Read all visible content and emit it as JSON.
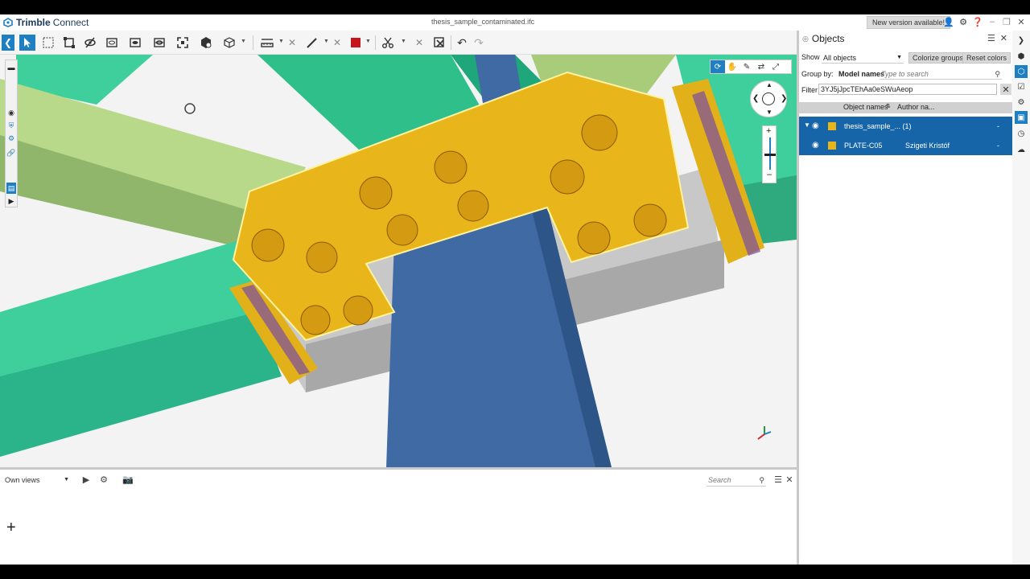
{
  "app": {
    "brand_bold": "Trimble",
    "brand_light": "Connect",
    "filename": "thesis_sample_contaminated.ifc",
    "new_version": "New version available!"
  },
  "bottom": {
    "views_select": "Own views",
    "search_placeholder": "Search",
    "add_label": "+"
  },
  "objects_panel": {
    "title": "Objects",
    "show_label": "Show",
    "show_value": "All objects",
    "colorize_groups": "Colorize groups",
    "reset_colors": "Reset colors",
    "group_by_label": "Group by:",
    "group_by_value": "Model names",
    "search_placeholder": "Type to search",
    "filter_label": "Filter",
    "filter_value": "3YJ5jJpcTEhAa0eSWuAeop",
    "columns": [
      "Object names",
      "Author na..."
    ],
    "rows": [
      {
        "name": "thesis_sample_... (1)",
        "author": "",
        "value": "-"
      },
      {
        "name": "PLATE-C05",
        "author": "Szigeti Kristóf",
        "value": "-"
      }
    ]
  },
  "colors": {
    "accent": "#1e7fc3",
    "selection_row": "#1565a8",
    "plate": "#e8b51a",
    "beam_green": "#3fcf9c",
    "beam_blue": "#3f6aa3"
  },
  "icons": {
    "toolbar": [
      "back-icon",
      "select-arrow-icon",
      "box-select-icon",
      "fit-icon",
      "hide-icon",
      "section-icon",
      "clip-icon",
      "isolate-icon",
      "expand-icon",
      "object-icon",
      "cube-icon",
      "measure-icon",
      "pen-icon",
      "color-square-icon",
      "scissors-icon",
      "clear-icon",
      "undo-icon",
      "redo-icon"
    ]
  }
}
